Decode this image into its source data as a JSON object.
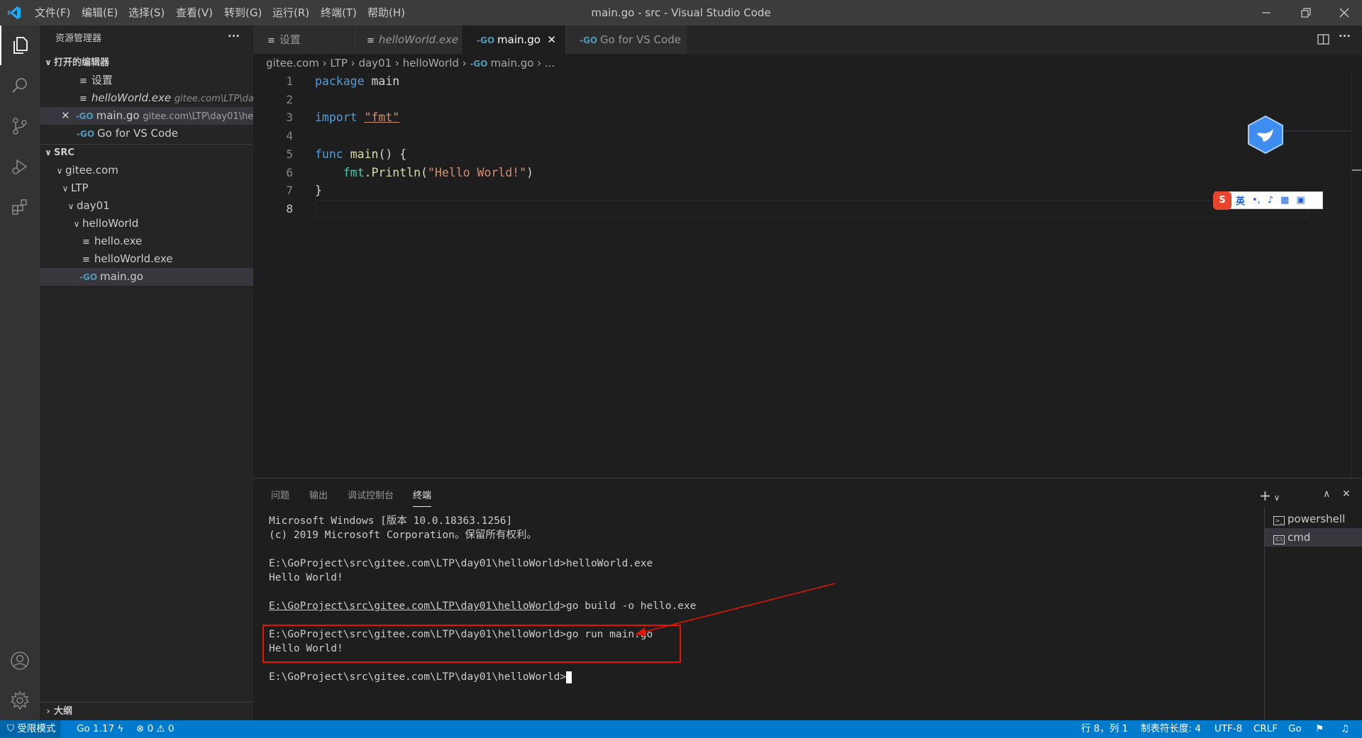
{
  "titlebar": {
    "menus": [
      "文件(F)",
      "编辑(E)",
      "选择(S)",
      "查看(V)",
      "转到(G)",
      "运行(R)",
      "终端(T)",
      "帮助(H)"
    ],
    "window_title": "main.go - src - Visual Studio Code"
  },
  "sidebar": {
    "title": "资源管理器",
    "more": "···",
    "open_editors_header": "打开的编辑器",
    "open_editors": [
      {
        "name": "设置",
        "path": ""
      },
      {
        "name": "helloWorld.exe",
        "path": "gitee.com\\LTP\\day..."
      },
      {
        "name": "main.go",
        "path": "gitee.com\\LTP\\day01\\hell..."
      },
      {
        "name": "Go for VS Code",
        "path": ""
      }
    ],
    "src_header": "SRC",
    "tree": [
      "gitee.com",
      "LTP",
      "day01",
      "helloWorld",
      "hello.exe",
      "helloWorld.exe",
      "main.go"
    ],
    "outline": "大纲"
  },
  "tabs": [
    "设置",
    "helloWorld.exe",
    "main.go",
    "Go for VS Code"
  ],
  "breadcrumb": [
    "gitee.com",
    "LTP",
    "day01",
    "helloWorld",
    "main.go",
    "..."
  ],
  "editor": {
    "line_numbers": [
      "1",
      "2",
      "3",
      "4",
      "5",
      "6",
      "7",
      "8"
    ],
    "code": {
      "kw_package": "package",
      "pkg_name": "main",
      "kw_import": "import",
      "import_path": "\"fmt\"",
      "kw_func": "func",
      "fn_main": "main",
      "fn_main_rest": "() {",
      "pkg_fmt": "fmt",
      "dot_println": ".Println(",
      "hello_str": "\"Hello World!\"",
      "close_paren": ")",
      "close_brace": "}"
    }
  },
  "ime": {
    "lang": "英"
  },
  "panel": {
    "tabs": [
      "问题",
      "输出",
      "调试控制台",
      "终端"
    ],
    "terminal": {
      "l1": "Microsoft Windows [版本 10.0.18363.1256]",
      "l2": "(c) 2019 Microsoft Corporation。保留所有权利。",
      "l3": "E:\\GoProject\\src\\gitee.com\\LTP\\day01\\helloWorld>helloWorld.exe",
      "l4": "Hello World!",
      "l5_prompt": "E:\\GoProject\\src\\gitee.com\\LTP\\day01\\helloWorld",
      "l5_cmd": ">go build -o hello.exe",
      "l6": "E:\\GoProject\\src\\gitee.com\\LTP\\day01\\helloWorld>go run main.go",
      "l7": "Hello World!",
      "l8": "E:\\GoProject\\src\\gitee.com\\LTP\\day01\\helloWorld>"
    },
    "terminals": [
      "powershell",
      "cmd"
    ]
  },
  "statusbar": {
    "restricted": "受限模式",
    "go_version": "Go 1.17",
    "errors": "0",
    "warnings": "0",
    "position": "行 8，列 1",
    "tab_size": "制表符长度: 4",
    "encoding": "UTF-8",
    "eol": "CRLF",
    "language": "Go"
  },
  "colors": {
    "accent": "#007acc",
    "highlight_box": "#e51400"
  }
}
